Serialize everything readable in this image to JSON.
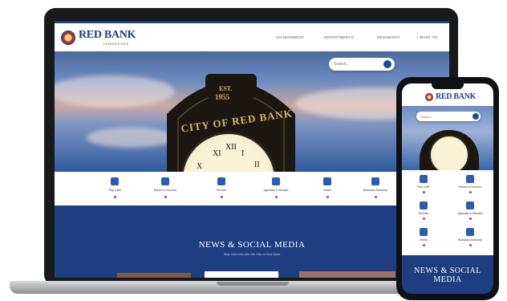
{
  "brand": {
    "name": "RED BANK",
    "subtitle": "TENNESSEE",
    "primary": "#1d3f82",
    "accent": "#b6322e"
  },
  "nav": {
    "items": [
      "GOVERNMENT",
      "DEPARTMENTS",
      "RESIDENTS",
      "I WANT TO"
    ]
  },
  "search": {
    "placeholder": "Search..."
  },
  "hero": {
    "est": "EST.",
    "year": "1955",
    "arch": "CITY OF RED BANK"
  },
  "quick_links": [
    {
      "label": "Pay a Bill",
      "icon": "payment-icon"
    },
    {
      "label": "Report a Concern",
      "icon": "person-icon"
    },
    {
      "label": "Permits",
      "icon": "document-icon"
    },
    {
      "label": "Agendas & Minutes",
      "icon": "clipboard-icon"
    },
    {
      "label": "News",
      "icon": "document-icon"
    },
    {
      "label": "Business Directory",
      "icon": "building-icon"
    }
  ],
  "news": {
    "title": "NEWS & SOCIAL MEDIA",
    "subtitle": "Stay informed with the City of Red Bank"
  },
  "mobile": {
    "title_line1": "NEWS & SOCIAL",
    "title_line2": "MEDIA"
  }
}
